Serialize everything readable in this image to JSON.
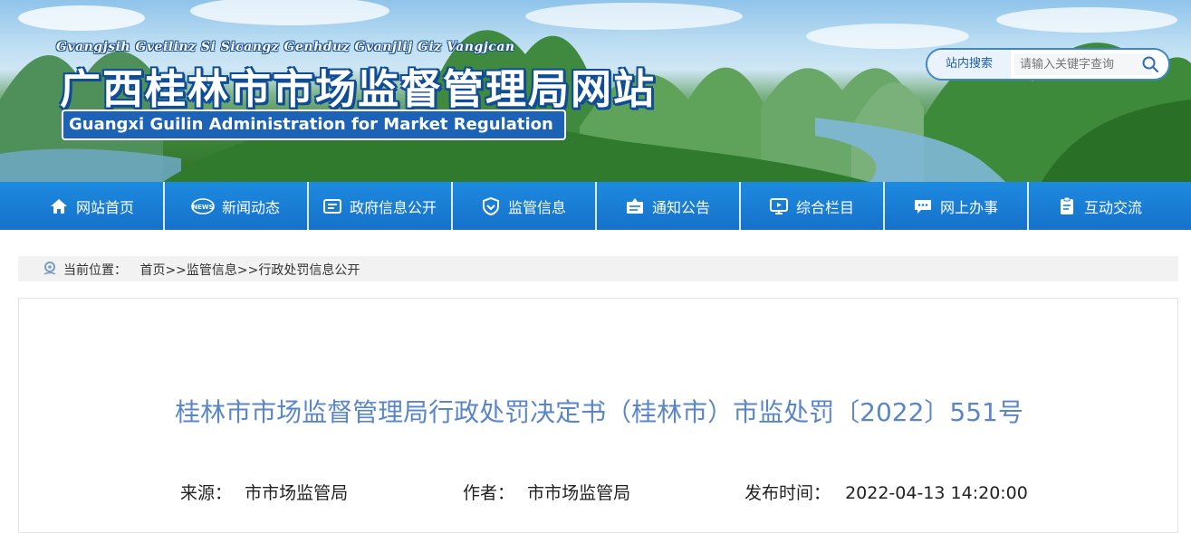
{
  "banner": {
    "pinyin": "Gvangjsih Gveilinz Si Sicangz Genhduz Gvanjlij Giz Vangjcan",
    "title": "广西桂林市市场监督管理局网站",
    "english": "Guangxi Guilin Administration for Market Regulation"
  },
  "search": {
    "label": "站内搜索",
    "placeholder": "请输入关键字查询",
    "icon": "search-icon"
  },
  "nav": {
    "items": [
      {
        "label": "网站首页",
        "icon": "home-icon"
      },
      {
        "label": "新闻动态",
        "icon": "news-icon"
      },
      {
        "label": "政府信息公开",
        "icon": "document-icon"
      },
      {
        "label": "监管信息",
        "icon": "shield-icon"
      },
      {
        "label": "通知公告",
        "icon": "notice-icon"
      },
      {
        "label": "综合栏目",
        "icon": "monitor-icon"
      },
      {
        "label": "网上办事",
        "icon": "chat-icon"
      },
      {
        "label": "互动交流",
        "icon": "clipboard-icon"
      }
    ]
  },
  "breadcrumb": {
    "prefix": "当前位置：",
    "items": [
      "首页",
      "监管信息",
      "行政处罚信息公开"
    ],
    "separator": ">>"
  },
  "article": {
    "title": "桂林市市场监督管理局行政处罚决定书（桂林市）市监处罚〔2022〕551号",
    "source_label": "来源：",
    "source": "市市场监管局",
    "author_label": "作者：",
    "author": "市市场监管局",
    "time_label": "发布时间：",
    "time": "2022-04-13 14:20:00"
  },
  "colors": {
    "nav": "#1a7fd6",
    "title": "#5a86c8",
    "brand_dark": "#0f4c98"
  }
}
